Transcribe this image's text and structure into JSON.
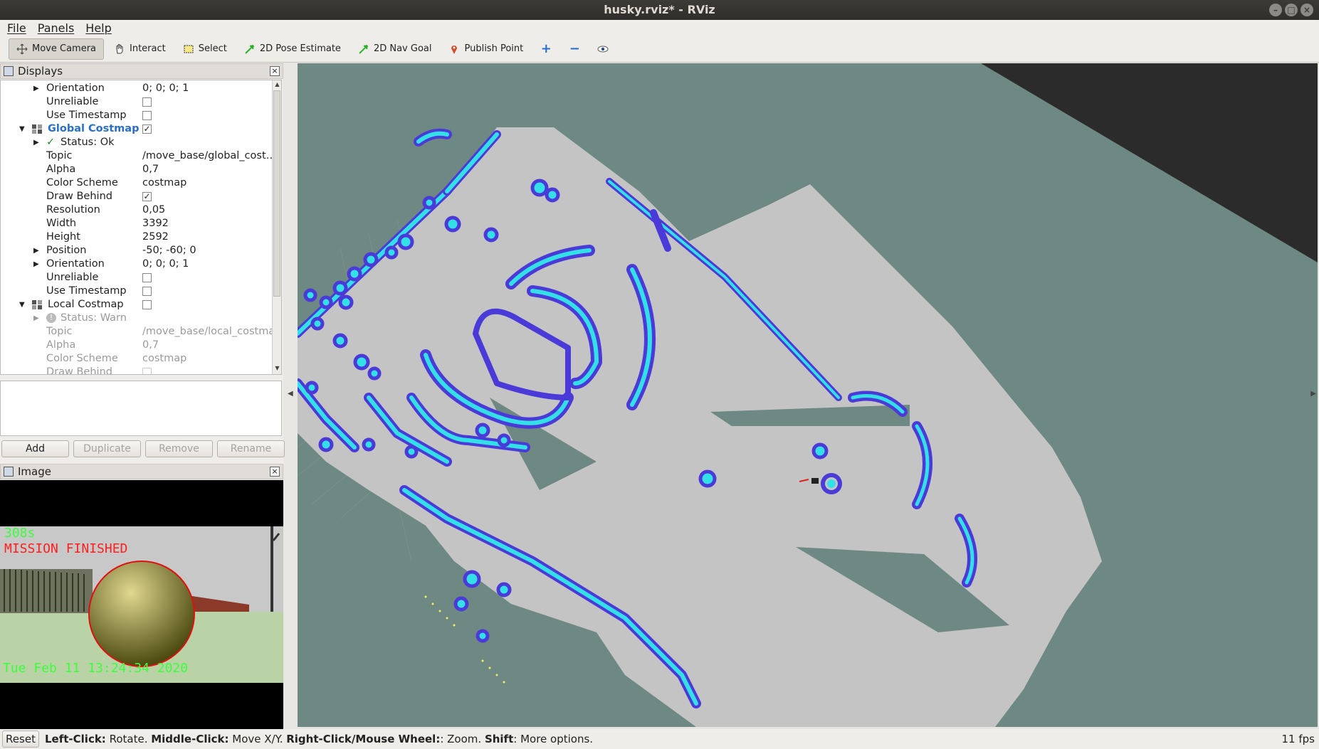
{
  "window": {
    "title": "husky.rviz* - RViz"
  },
  "menu": {
    "file": "File",
    "panels": "Panels",
    "help": "Help"
  },
  "toolbar": {
    "move_camera": "Move Camera",
    "interact": "Interact",
    "select": "Select",
    "pose_estimate": "2D Pose Estimate",
    "nav_goal": "2D Nav Goal",
    "publish_point": "Publish Point"
  },
  "displays": {
    "title": "Displays",
    "rows": [
      {
        "label": "Orientation",
        "value": "0; 0; 0; 1"
      },
      {
        "label": "Unreliable"
      },
      {
        "label": "Use Timestamp"
      },
      {
        "label": "Global Costmap"
      },
      {
        "label": "Status: Ok"
      },
      {
        "label": "Topic",
        "value": "/move_base/global_cost…"
      },
      {
        "label": "Alpha",
        "value": "0,7"
      },
      {
        "label": "Color Scheme",
        "value": "costmap"
      },
      {
        "label": "Draw Behind"
      },
      {
        "label": "Resolution",
        "value": "0,05"
      },
      {
        "label": "Width",
        "value": "3392"
      },
      {
        "label": "Height",
        "value": "2592"
      },
      {
        "label": "Position",
        "value": "-50; -60; 0"
      },
      {
        "label": "Orientation",
        "value": "0; 0; 0; 1"
      },
      {
        "label": "Unreliable"
      },
      {
        "label": "Use Timestamp"
      },
      {
        "label": "Local Costmap"
      },
      {
        "label": "Status: Warn"
      },
      {
        "label": "Topic",
        "value": "/move_base/local_costma…"
      },
      {
        "label": "Alpha",
        "value": "0,7"
      },
      {
        "label": "Color Scheme",
        "value": "costmap"
      },
      {
        "label": "Draw Behind"
      }
    ],
    "buttons": {
      "add": "Add",
      "duplicate": "Duplicate",
      "remove": "Remove",
      "rename": "Rename"
    }
  },
  "image_panel": {
    "title": "Image",
    "timer": "308s",
    "mission": "MISSION FINISHED",
    "date": "Tue Feb 11 13:24:34 2020"
  },
  "status": {
    "reset": "Reset",
    "left_click": "Left-Click:",
    "left_click_action": " Rotate. ",
    "middle_click": "Middle-Click:",
    "middle_click_action": " Move X/Y. ",
    "right_click": "Right-Click/Mouse Wheel:",
    "right_click_action": ": Zoom. ",
    "shift": "Shift",
    "shift_action": ": More options.",
    "fps": "11 fps"
  },
  "colors": {
    "obstacle": "#33e0e8",
    "inflation": "#4a3ad8",
    "free": "#c4c4c4",
    "background": "#6e8883"
  }
}
